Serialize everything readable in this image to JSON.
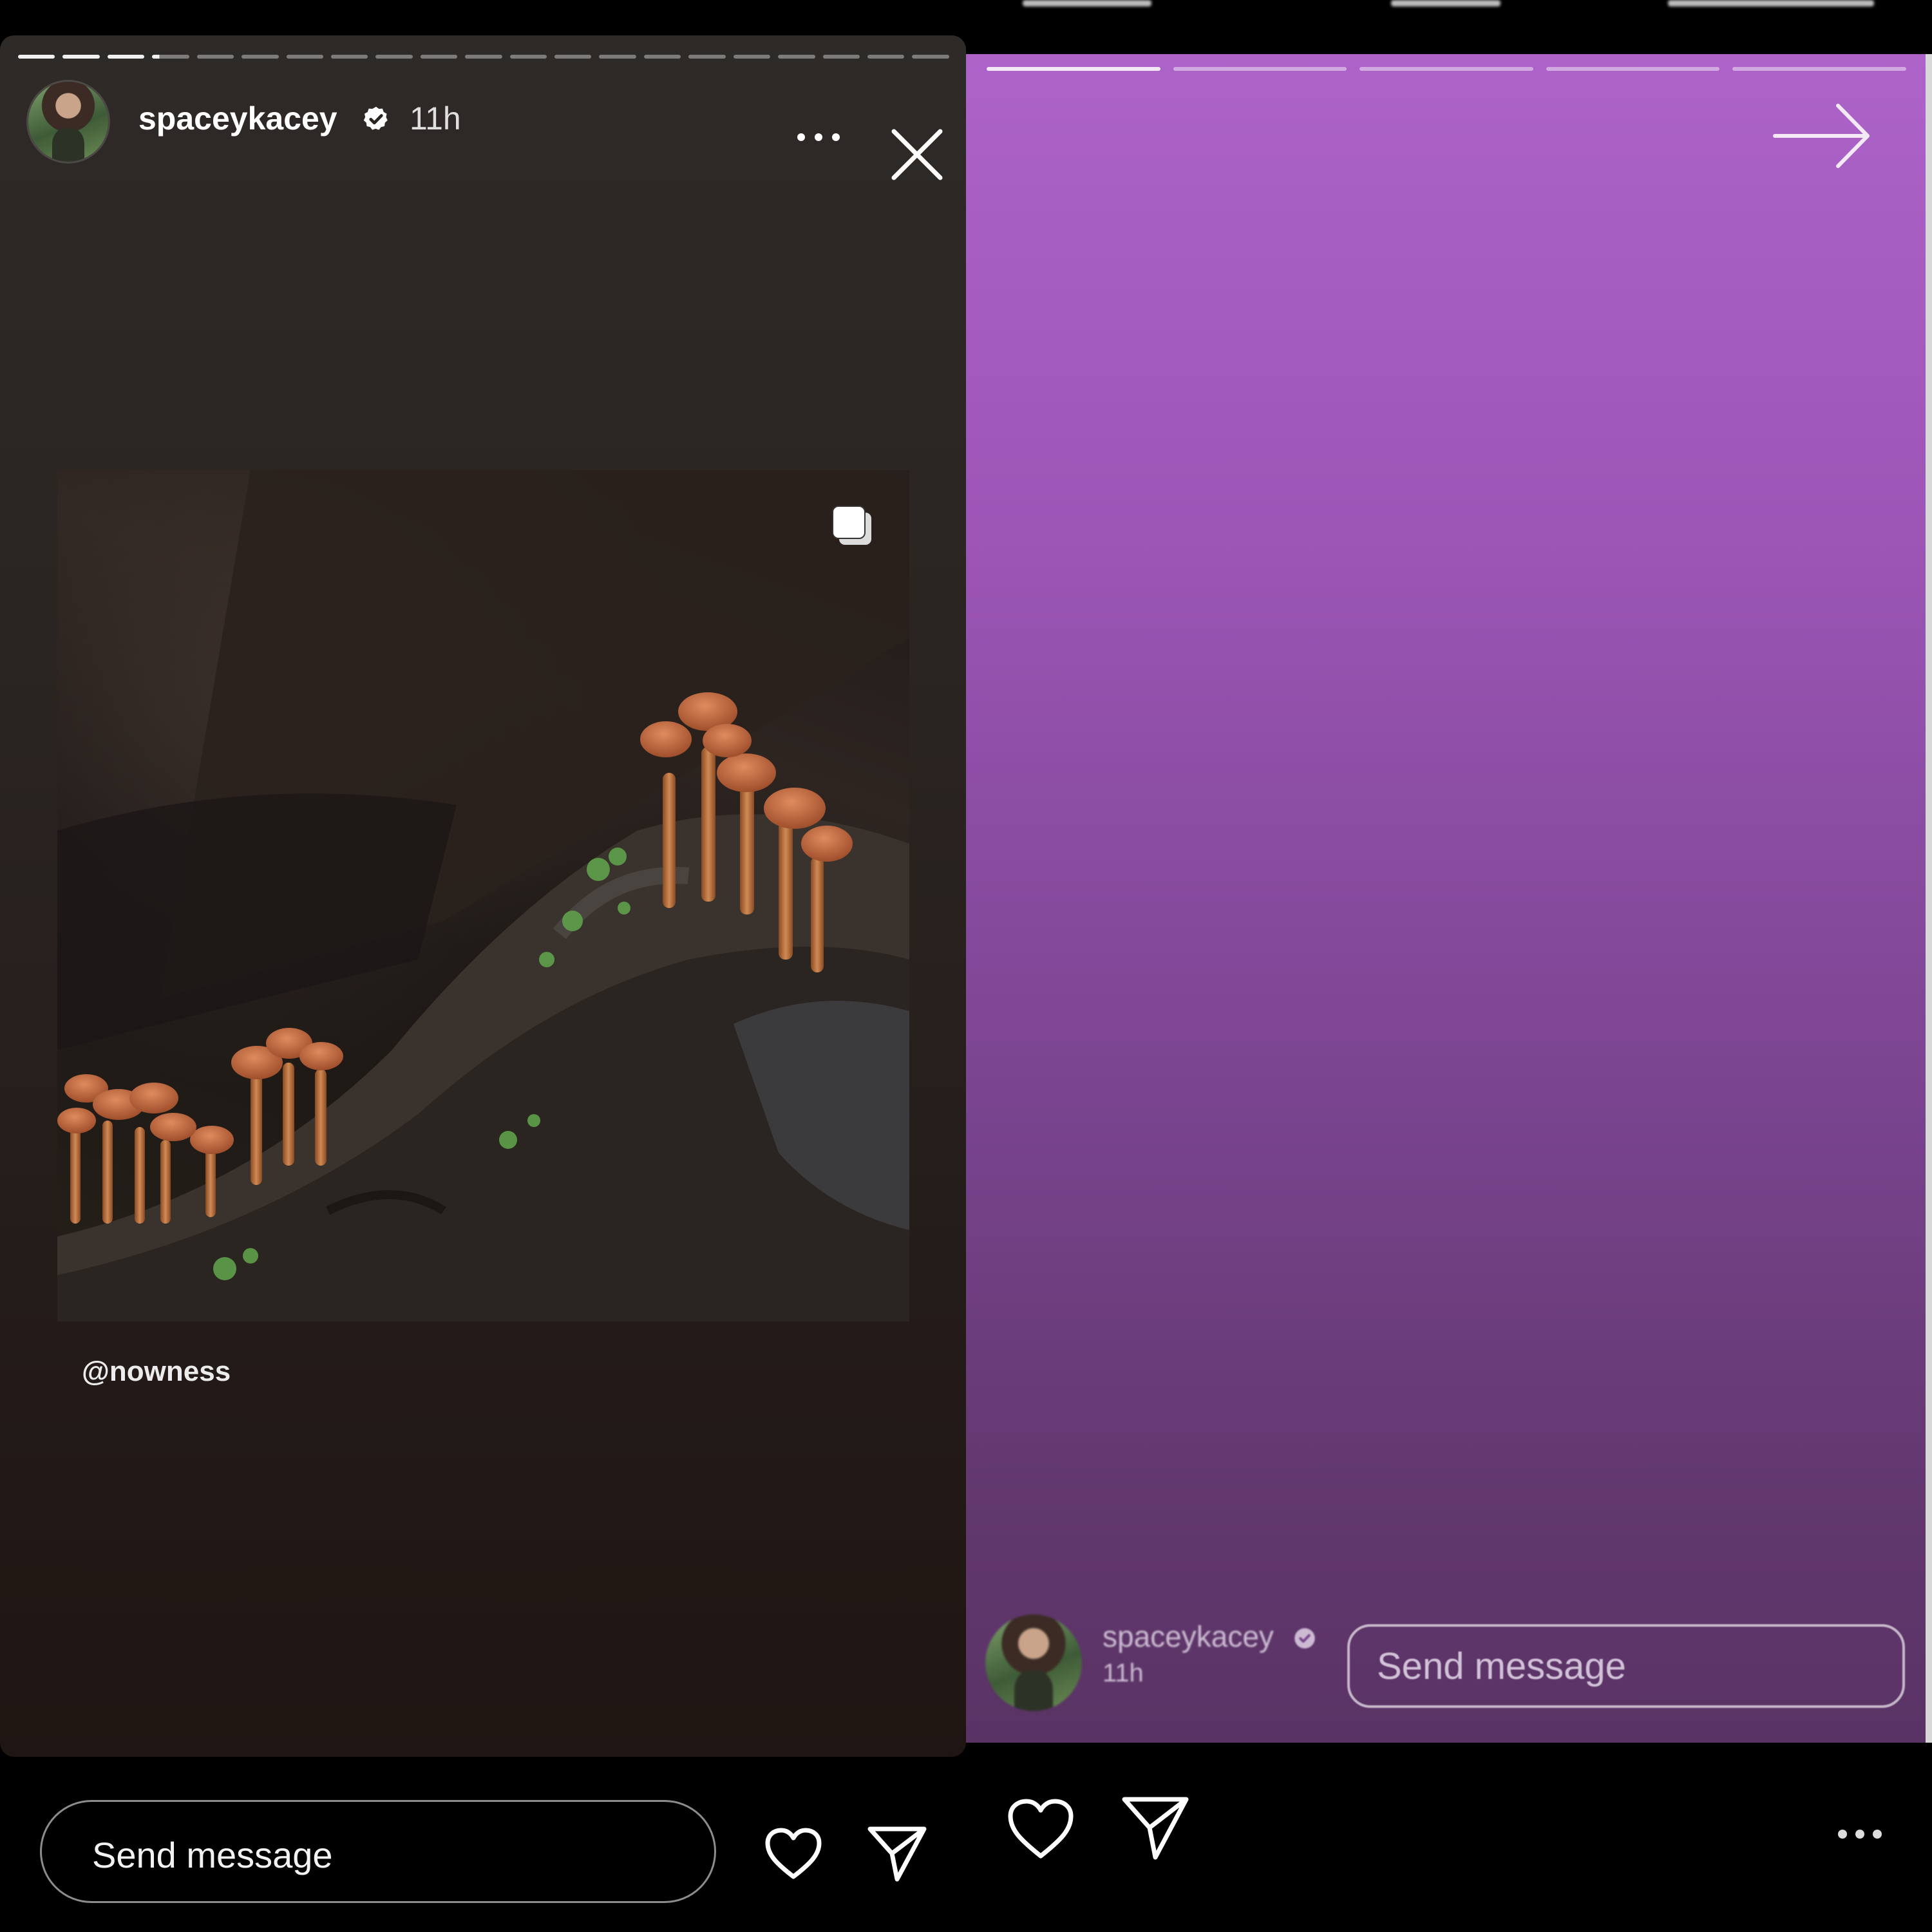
{
  "left": {
    "username": "spaceykacey",
    "time": "11h",
    "mention": "@nowness",
    "send_placeholder": "Send message",
    "progress": {
      "segments": 21,
      "seen": 3,
      "current_fraction": 0.2
    }
  },
  "right": {
    "username": "spaceykacey",
    "time": "11h",
    "send_placeholder": "Send message",
    "progress": {
      "segments": 5,
      "seen": 1
    },
    "background_colors": [
      "#ad63c8",
      "#5a3365"
    ]
  },
  "icons": {
    "verified": "verified-badge-icon",
    "more": "more-horizontal-icon",
    "close": "close-icon",
    "carousel": "carousel-icon",
    "heart": "heart-icon",
    "share": "paper-plane-icon",
    "next": "arrow-right-icon"
  }
}
